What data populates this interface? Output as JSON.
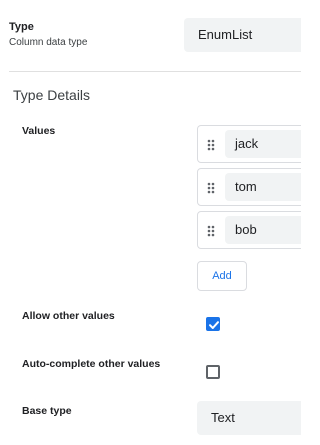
{
  "type_field": {
    "label": "Type",
    "sublabel": "Column data type",
    "value": "EnumList"
  },
  "type_details": {
    "title": "Type Details",
    "values_label": "Values",
    "values": [
      "jack",
      "tom",
      "bob"
    ],
    "add_label": "Add",
    "allow_other_label": "Allow other values",
    "allow_other_checked": true,
    "autocomplete_label": "Auto-complete other values",
    "autocomplete_checked": false,
    "base_type_label": "Base type",
    "base_type_value": "Text"
  },
  "colors": {
    "accent": "#1a73e8",
    "field_bg": "#f1f3f4",
    "border": "#dadce0"
  },
  "icons": {
    "drag": "drag-handle-icon",
    "check": "check-icon"
  }
}
